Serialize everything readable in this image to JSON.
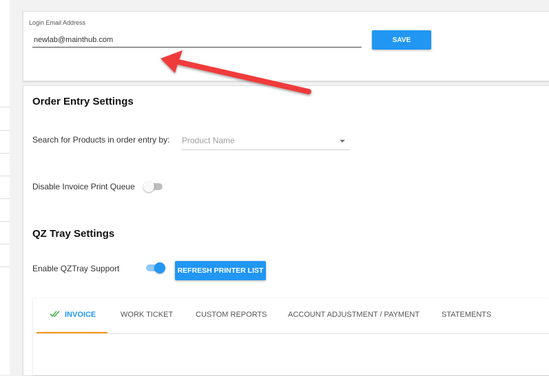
{
  "email": {
    "label": "Login Email Address",
    "value": "newlab@mainthub.com",
    "save_label": "SAVE"
  },
  "order_entry": {
    "title": "Order Entry Settings",
    "search_label": "Search for Products in order entry by:",
    "search_value": "Product Name",
    "disable_print_label": "Disable Invoice Print Queue",
    "disable_print_enabled": false
  },
  "qz_tray": {
    "title": "QZ Tray Settings",
    "enable_label": "Enable QZTray Support",
    "enabled": true,
    "refresh_label": "REFRESH PRINTER LIST"
  },
  "tabs": [
    {
      "label": "INVOICE",
      "active": true,
      "icon": "double-check-icon"
    },
    {
      "label": "WORK TICKET",
      "active": false
    },
    {
      "label": "CUSTOM REPORTS",
      "active": false
    },
    {
      "label": "ACCOUNT ADJUSTMENT / PAYMENT",
      "active": false
    },
    {
      "label": "STATEMENTS",
      "active": false
    }
  ],
  "colors": {
    "primary": "#2196f3",
    "tab_indicator": "#ff9800",
    "annotation_arrow": "#f03a3a"
  }
}
